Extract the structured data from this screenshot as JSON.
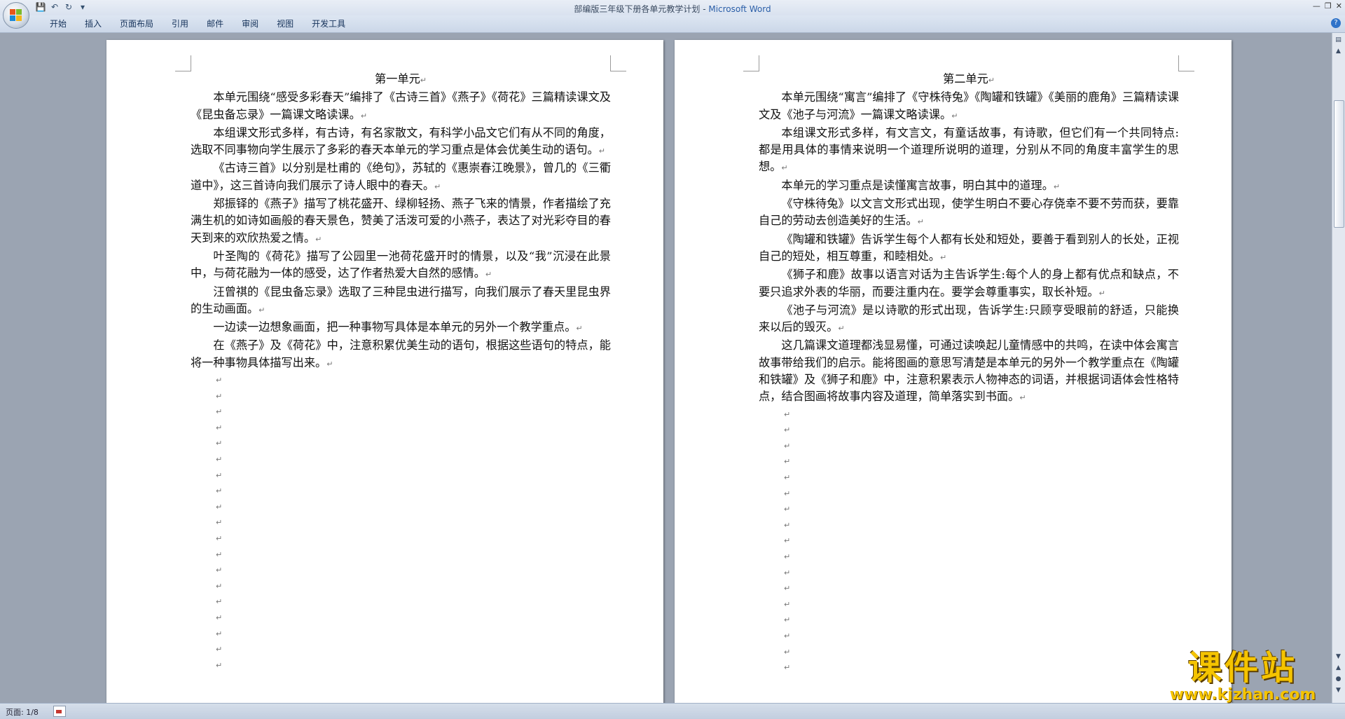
{
  "window": {
    "doc_name": "部编版三年级下册各单元教学计划",
    "separator": " - ",
    "app_name": "Microsoft Word"
  },
  "tabs": [
    "开始",
    "插入",
    "页面布局",
    "引用",
    "邮件",
    "审阅",
    "视图",
    "开发工具"
  ],
  "pages": [
    {
      "title": "第一单元",
      "paragraphs": [
        "本单元围绕“感受多彩春天”编排了《古诗三首》《燕子》《荷花》三篇精读课文及《昆虫备忘录》一篇课文略读课。",
        "本组课文形式多样，有古诗，有名家散文，有科学小品文它们有从不同的角度，选取不同事物向学生展示了多彩的春天本单元的学习重点是体会优美生动的语句。",
        "《古诗三首》以分别是杜甫的《绝句》，苏轼的《惠崇春江晚景》，曾几的《三衢道中》，这三首诗向我们展示了诗人眼中的春天。",
        "郑振铎的《燕子》描写了桃花盛开、绿柳轻扬、燕子飞来的情景，作者描绘了充满生机的如诗如画般的春天景色，赞美了活泼可爱的小燕子，表达了对光彩夺目的春天到来的欢欣热爱之情。",
        "叶圣陶的《荷花》描写了公园里一池荷花盛开时的情景，以及“我”沉浸在此景中，与荷花融为一体的感受，达了作者热爱大自然的感情。",
        "汪曾祺的《昆虫备忘录》选取了三种昆虫进行描写，向我们展示了春天里昆虫界的生动画面。",
        "一边读一边想象画面，把一种事物写具体是本单元的另外一个教学重点。",
        "在《燕子》及《荷花》中，注意积累优美生动的语句，根据这些语句的特点，能将一种事物具体描写出来。"
      ],
      "empty_lines": 19
    },
    {
      "title": "第二单元",
      "paragraphs": [
        "本单元围绕“寓言”编排了《守株待兔》《陶罐和铁罐》《美丽的鹿角》三篇精读课文及《池子与河流》一篇课文略读课。",
        "本组课文形式多样，有文言文，有童话故事，有诗歌，但它们有一个共同特点:都是用具体的事情来说明一个道理所说明的道理，分别从不同的角度丰富学生的思想。",
        "本单元的学习重点是读懂寓言故事，明白其中的道理。",
        "《守株待兔》以文言文形式出现，使学生明白不要心存侥幸不要不劳而获，要靠自己的劳动去创造美好的生活。",
        "《陶罐和铁罐》告诉学生每个人都有长处和短处，要善于看到别人的长处，正视自己的短处，相互尊重，和睦相处。",
        "《狮子和鹿》故事以语言对话为主告诉学生:每个人的身上都有优点和缺点，不要只追求外表的华丽，而要注重内在。要学会尊重事实，取长补短。",
        "《池子与河流》是以诗歌的形式出现，告诉学生:只顾亨受眼前的舒适，只能换来以后的毁灭。",
        "这几篇课文道理都浅显易懂，可通过读唤起儿童情感中的共鸣，在读中体会寓言故事带给我们的启示。能将图画的意思写清楚是本单元的另外一个教学重点在《陶罐和铁罐》及《狮子和鹿》中，注意积累表示人物神态的词语，并根据词语体会性格特点，结合图画将故事内容及道理，简单落实到书面。"
      ],
      "empty_lines": 17
    }
  ],
  "para_mark": "↵",
  "status": {
    "page": "页面: 1/8"
  },
  "watermark": {
    "text": "课件站",
    "url": "www.kjzhan.com"
  }
}
